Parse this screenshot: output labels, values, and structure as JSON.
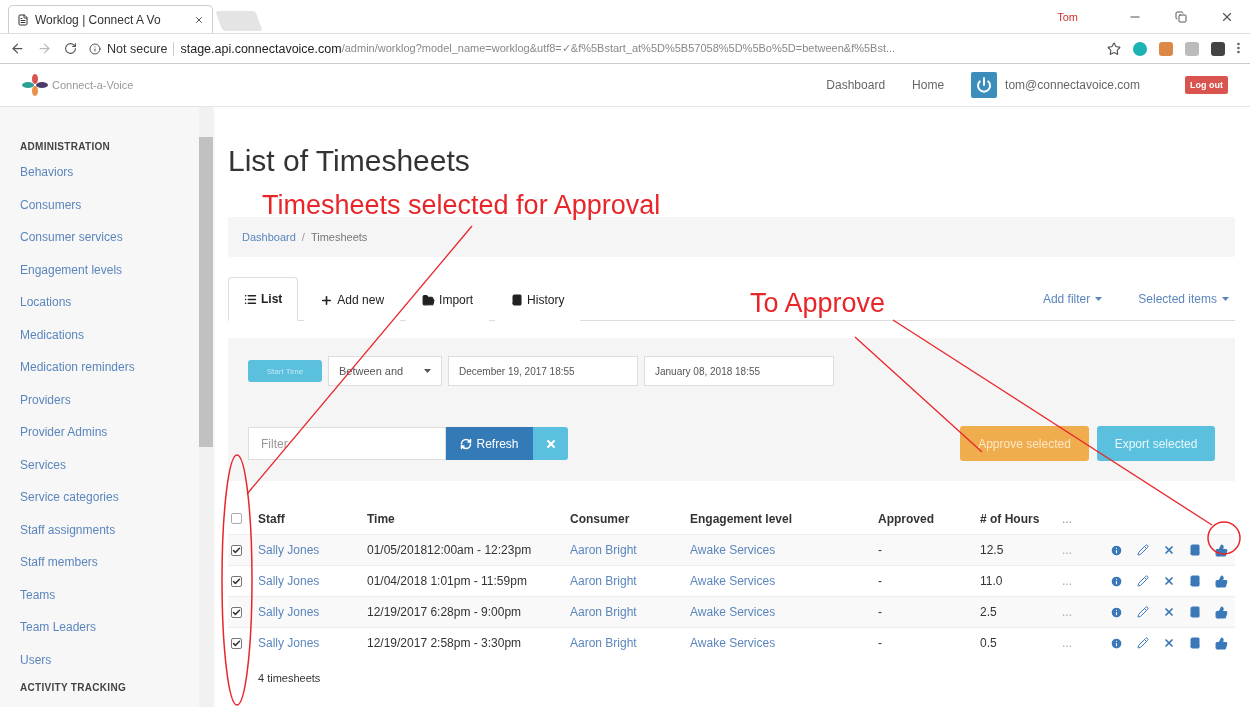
{
  "browser": {
    "tab_title": "Worklog | Connect A Vo",
    "profile": "Tom",
    "security": "Not secure",
    "url_host": "stage.api.connectavoice.com",
    "url_path": "/admin/worklog?model_name=worklog&utf8=✓&f%5Bstart_at%5D%5B57058%5D%5Bo%5D=between&f%5Bst..."
  },
  "header": {
    "brand": "Connect-a-Voice",
    "nav": [
      "Dashboard",
      "Home"
    ],
    "user": "tom@connectavoice.com",
    "logout": "Log out"
  },
  "sidebar": {
    "section_title": "ADMINISTRATION",
    "items": [
      "Behaviors",
      "Consumers",
      "Consumer services",
      "Engagement levels",
      "Locations",
      "Medications",
      "Medication reminders",
      "Providers",
      "Provider Admins",
      "Services",
      "Service categories",
      "Staff assignments",
      "Staff members",
      "Teams",
      "Team Leaders",
      "Users"
    ],
    "next_section": "ACTIVITY TRACKING"
  },
  "page": {
    "title": "List of Timesheets",
    "breadcrumb": [
      "Dashboard",
      "Timesheets"
    ],
    "breadcrumb_separator": "/"
  },
  "tabs": [
    {
      "label": "List",
      "selected": true
    },
    {
      "label": "Add new",
      "selected": false
    },
    {
      "label": "Import",
      "selected": false
    },
    {
      "label": "History",
      "selected": false
    }
  ],
  "menus": [
    "Add filter",
    "Selected items"
  ],
  "filter": {
    "field_button": "Start Time",
    "operator": "Between and",
    "from": "December 19, 2017 18:55",
    "to": "January 08, 2018 18:55",
    "search_placeholder": "Filter",
    "refresh": "Refresh",
    "approve": "Approve selected",
    "export": "Export selected"
  },
  "table": {
    "select_all": false,
    "columns": [
      "Staff",
      "Time",
      "Consumer",
      "Engagement level",
      "Approved",
      "# of Hours",
      "..."
    ],
    "rows": [
      {
        "checked": true,
        "staff": "Sally Jones",
        "time": "01/05/201812:00am - 12:23pm",
        "consumer": "Aaron Bright",
        "engagement": "Awake Services",
        "approved": "-",
        "hours": "12.5",
        "more": "..."
      },
      {
        "checked": true,
        "staff": "Sally Jones",
        "time": "01/04/2018 1:01pm - 11:59pm",
        "consumer": "Aaron Bright",
        "engagement": "Awake Services",
        "approved": "-",
        "hours": "11.0",
        "more": "..."
      },
      {
        "checked": true,
        "staff": "Sally Jones",
        "time": "12/19/2017 6:28pm - 9:00pm",
        "consumer": "Aaron Bright",
        "engagement": "Awake Services",
        "approved": "-",
        "hours": "2.5",
        "more": "..."
      },
      {
        "checked": true,
        "staff": "Sally Jones",
        "time": "12/19/2017 2:58pm - 3:30pm",
        "consumer": "Aaron Bright",
        "engagement": "Awake Services",
        "approved": "-",
        "hours": "0.5",
        "more": "..."
      }
    ]
  },
  "footer": "4 timesheets",
  "annotations": {
    "selected_label": "Timesheets selected for Approval",
    "approve_label": "To Approve"
  }
}
